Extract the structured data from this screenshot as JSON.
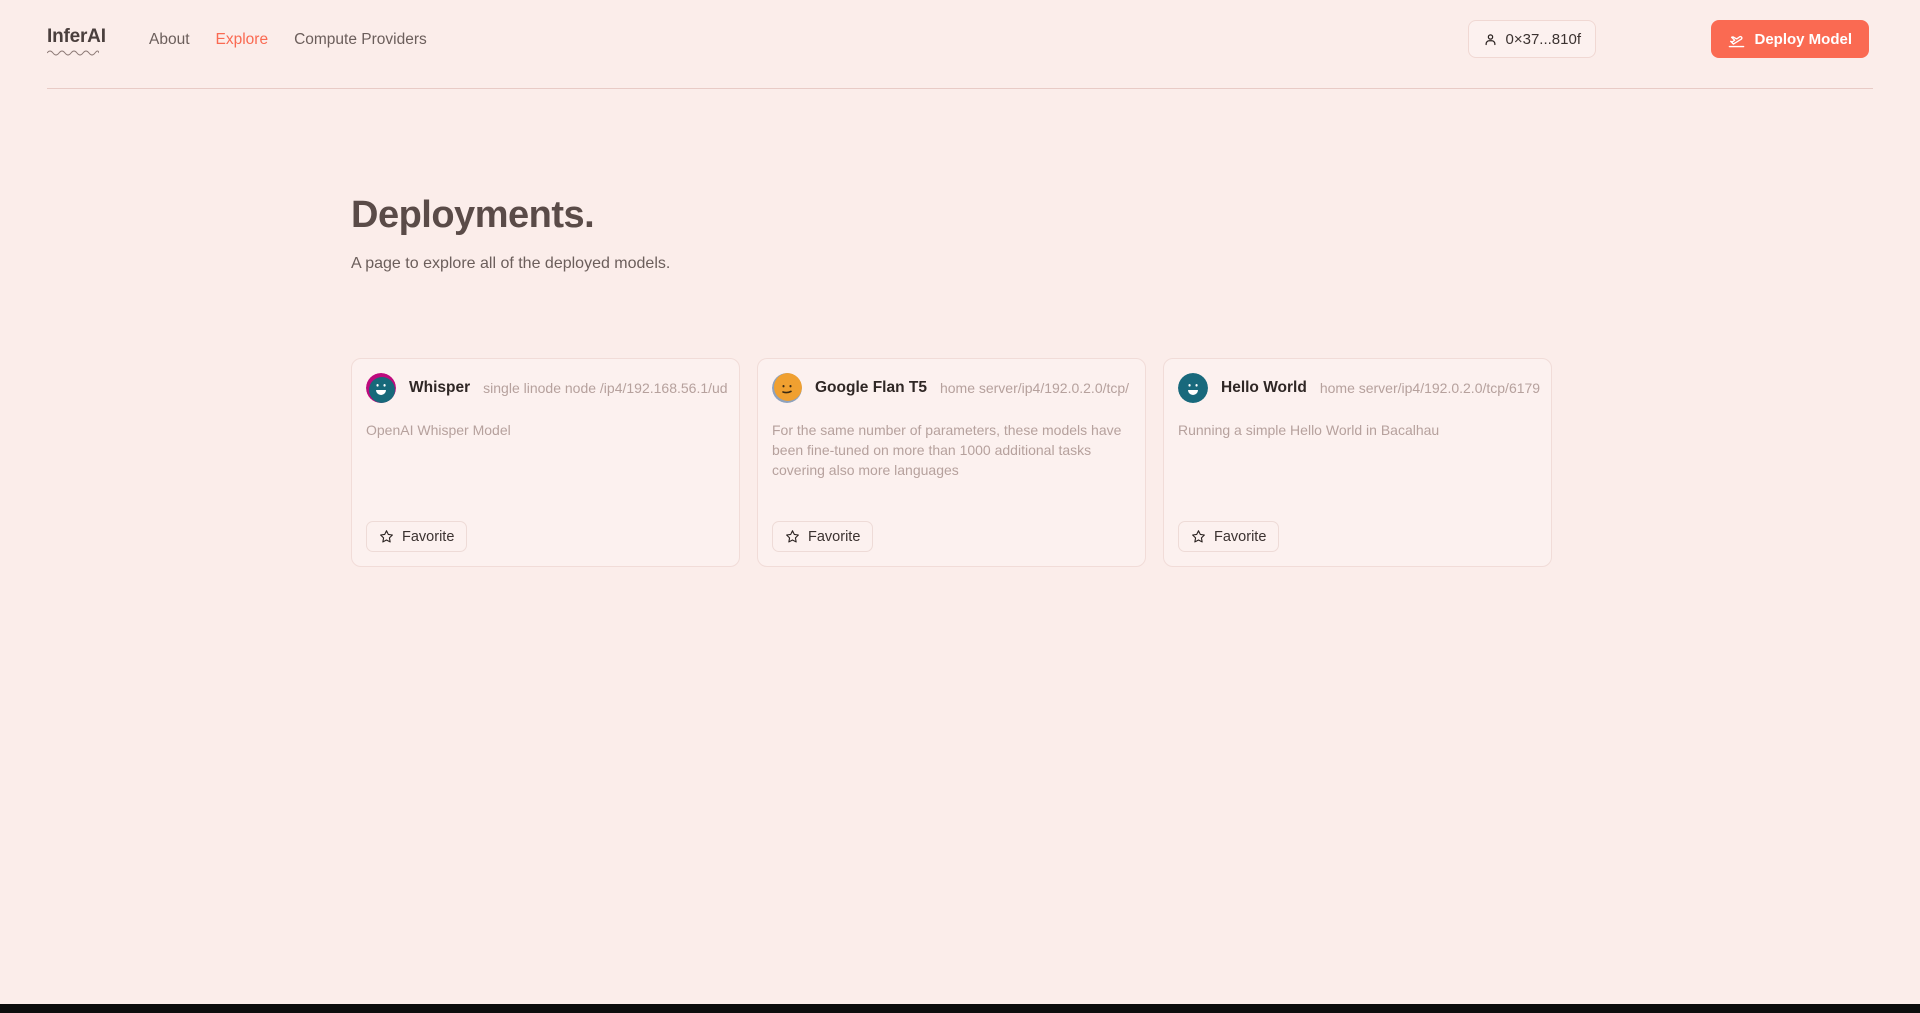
{
  "brand": {
    "name": "InferAI",
    "squiggle_icon": "wavy-underline"
  },
  "nav": {
    "links": [
      {
        "label": "About",
        "active": false
      },
      {
        "label": "Explore",
        "active": true
      },
      {
        "label": "Compute Providers",
        "active": false
      }
    ],
    "wallet": {
      "label": "0×37...810f",
      "icon": "user-icon"
    },
    "deploy": {
      "label": "Deploy Model",
      "icon": "plane-takeoff-icon"
    }
  },
  "header": {
    "title": "Deployments.",
    "subtitle": "A page to explore all of the deployed models."
  },
  "cards": [
    {
      "title": "Whisper",
      "address": "single linode node /ip4/192.168.56.1/ud",
      "description": "OpenAI Whisper Model",
      "favorite_label": "Favorite",
      "avatar": {
        "name": "whisper-avatar",
        "base": "#17697a",
        "accent": "#bd0a7d",
        "mouth": "smile"
      }
    },
    {
      "title": "Google Flan T5",
      "address": "home server/ip4/192.0.2.0/tcp/",
      "description": "For the same number of parameters, these models have been fine-tuned on more than 1000 additional tasks covering also more languages",
      "favorite_label": "Favorite",
      "avatar": {
        "name": "google-flan-t5-avatar",
        "base": "#f0a030",
        "accent": "#8ea2bd",
        "mouth": "flat"
      }
    },
    {
      "title": "Hello World",
      "address": "home server/ip4/192.0.2.0/tcp/6179",
      "description": "Running a simple Hello World in Bacalhau",
      "favorite_label": "Favorite",
      "avatar": {
        "name": "hello-world-avatar",
        "base": "#18697c",
        "accent": "#18697c",
        "mouth": "smile"
      }
    }
  ],
  "colors": {
    "background": "#fbedea",
    "accent": "#fa6a52",
    "card_background": "#fcf1ef",
    "card_border": "#f1dcd8",
    "muted_text": "#b6a19d"
  }
}
